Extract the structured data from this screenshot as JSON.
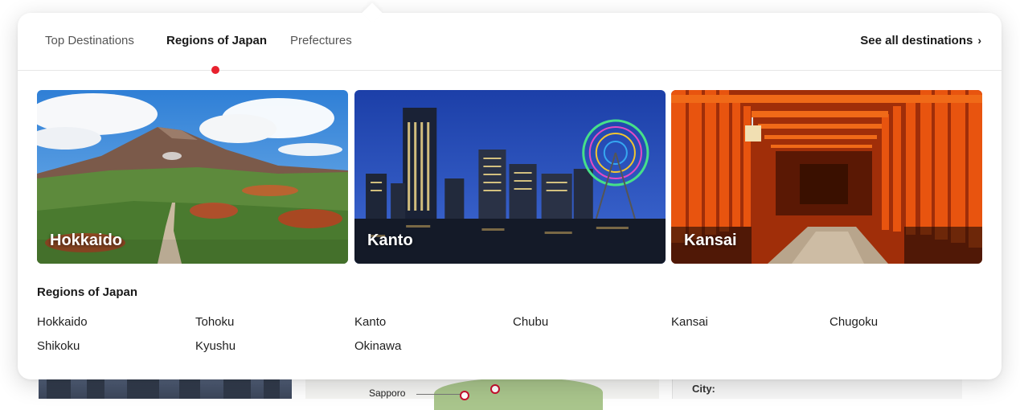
{
  "tabs": [
    {
      "label": "Top Destinations",
      "active": false
    },
    {
      "label": "Regions of Japan",
      "active": true
    },
    {
      "label": "Prefectures",
      "active": false
    }
  ],
  "see_all_label": "See all destinations",
  "see_all_icon": "chevron-right-icon",
  "accent_color": "#e8212e",
  "cards": [
    {
      "title": "Hokkaido"
    },
    {
      "title": "Kanto"
    },
    {
      "title": "Kansai"
    }
  ],
  "list": {
    "heading": "Regions of Japan",
    "items": [
      "Hokkaido",
      "Tohoku",
      "Kanto",
      "Chubu",
      "Kansai",
      "Chugoku",
      "Shikoku",
      "Kyushu",
      "Okinawa"
    ]
  },
  "background": {
    "map_label": "Sapporo",
    "info_label": "City:"
  }
}
